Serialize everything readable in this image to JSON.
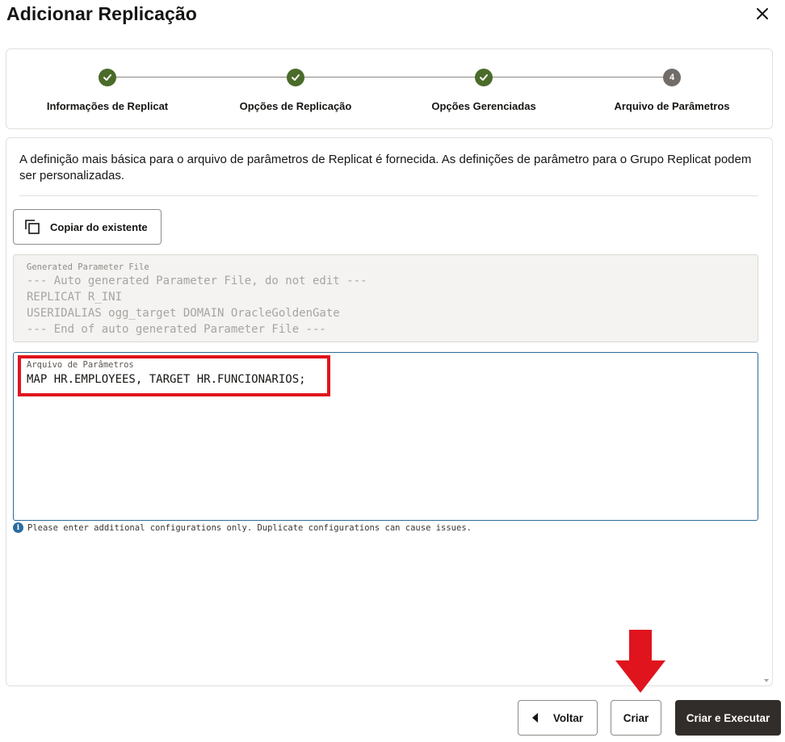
{
  "dialog": {
    "title": "Adicionar Replicação",
    "close_icon": "close-icon"
  },
  "train": {
    "steps": [
      {
        "label": "Informações de Replicat",
        "status": "done"
      },
      {
        "label": "Opções de Replicação",
        "status": "done"
      },
      {
        "label": "Opções Gerenciadas",
        "status": "done"
      },
      {
        "label": "Arquivo de Parâmetros",
        "status": "current",
        "number": "4"
      }
    ]
  },
  "content": {
    "intro": "A definição mais básica para o arquivo de parâmetros de Replicat é fornecida. As definições de parâmetro para o Grupo Replicat podem ser personalizadas.",
    "copy_button": "Copiar do existente",
    "generated": {
      "label": "Generated Parameter File",
      "lines": [
        "--- Auto generated Parameter File, do not edit ---",
        "REPLICAT R_INI",
        "USERIDALIAS ogg_target DOMAIN OracleGoldenGate",
        "--- End of auto generated Parameter File ---"
      ]
    },
    "param_file": {
      "label": "Arquivo de Parâmetros",
      "value": "MAP HR.EMPLOYEES, TARGET HR.FUNCIONARIOS;"
    },
    "hint": "Please enter additional configurations only. Duplicate configurations can cause issues."
  },
  "footer": {
    "back_label": "Voltar",
    "create_label": "Criar",
    "create_run_label": "Criar e Executar"
  },
  "colors": {
    "step_done": "#4b6b2a",
    "step_current": "#716c68",
    "focus_border": "#2b6c9e",
    "annotation_red": "#e0141d",
    "primary_button": "#312d2a"
  }
}
